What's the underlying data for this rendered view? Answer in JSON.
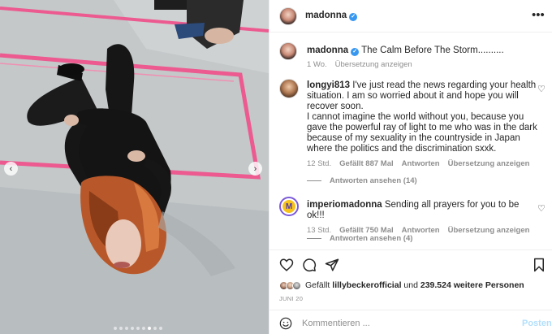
{
  "header": {
    "username": "madonna",
    "more_icon": "more-icon"
  },
  "caption": {
    "username": "madonna",
    "text": "The Calm Before The Storm..........",
    "time": "1 Wo.",
    "translate": "Übersetzung anzeigen"
  },
  "comments": [
    {
      "username": "longyi813",
      "text": "I've just read the news regarding your health situation. I am so worried about it and hope you will recover soon.\nI cannot imagine the world without you, because you gave the powerful ray of light to me who was in the dark because of my sexuality in the countryside in Japan where the politics and the discrimination sxxk.",
      "time": "12 Std.",
      "likes": "Gefällt 887 Mal",
      "reply": "Antworten",
      "translate": "Übersetzung anzeigen",
      "view_replies": "Antworten ansehen (14)"
    },
    {
      "username": "imperiomadonna",
      "text": "Sending all prayers for you to be ok!!!",
      "time": "13 Std.",
      "likes": "Gefällt 750 Mal",
      "reply": "Antworten",
      "translate": "Übersetzung anzeigen",
      "view_replies": "Antworten ansehen (4)",
      "avatar_letter": "M"
    }
  ],
  "likes": {
    "prefix": "Gefällt",
    "user": "lillybeckerofficial",
    "middle": "und",
    "count": "239.524 weitere Personen"
  },
  "date": "JUNI 20",
  "composer": {
    "placeholder": "Kommentieren ...",
    "post_label": "Posten"
  },
  "carousel": {
    "dots": 9,
    "active_index": 6
  },
  "colors": {
    "accent": "#3897f0",
    "muted": "#8e8e8e",
    "tape": "#ec5a8f",
    "post_disabled": "#b2dffc"
  }
}
